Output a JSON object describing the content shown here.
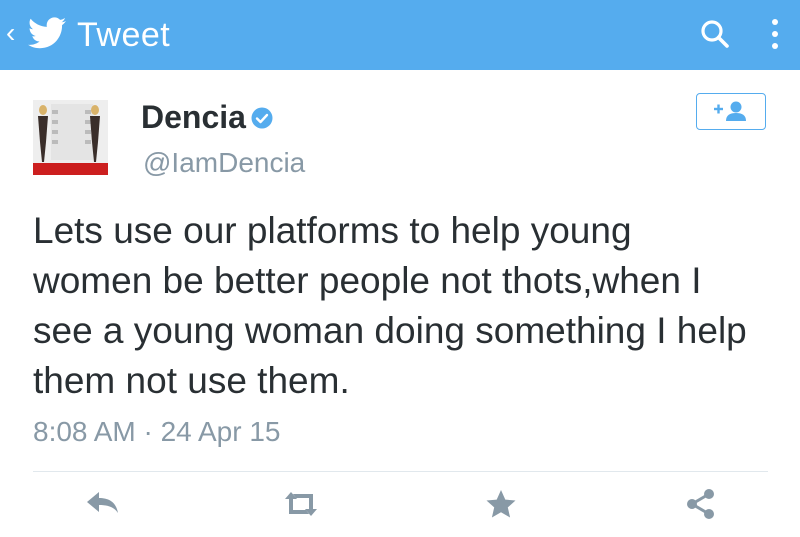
{
  "app_bar": {
    "title": "Tweet",
    "back_icon": "chevron-left-icon",
    "logo_icon": "twitter-bird-icon",
    "search_icon": "search-icon",
    "menu_icon": "overflow-menu-icon",
    "color": "#55acee"
  },
  "tweet": {
    "author": {
      "display_name": "Dencia",
      "handle": "@IamDencia",
      "verified": true,
      "avatar_icon": "avatar-photo"
    },
    "text": "Lets use our platforms to help young\nwomen be better people not thots,when I\nsee a young woman doing something I help\nthem not use them.",
    "timestamp": "8:08 AM · 24 Apr 15"
  },
  "follow_button": {
    "icon": "add-user-icon"
  },
  "actions": [
    {
      "name": "reply",
      "icon": "reply-icon"
    },
    {
      "name": "retweet",
      "icon": "retweet-icon"
    },
    {
      "name": "favorite",
      "icon": "star-icon"
    },
    {
      "name": "share",
      "icon": "share-icon"
    }
  ],
  "colors": {
    "accent": "#55acee",
    "text": "#292f33",
    "secondary_text": "#8899a6",
    "icon_gray": "#8899a6",
    "verified": "#55acee"
  }
}
